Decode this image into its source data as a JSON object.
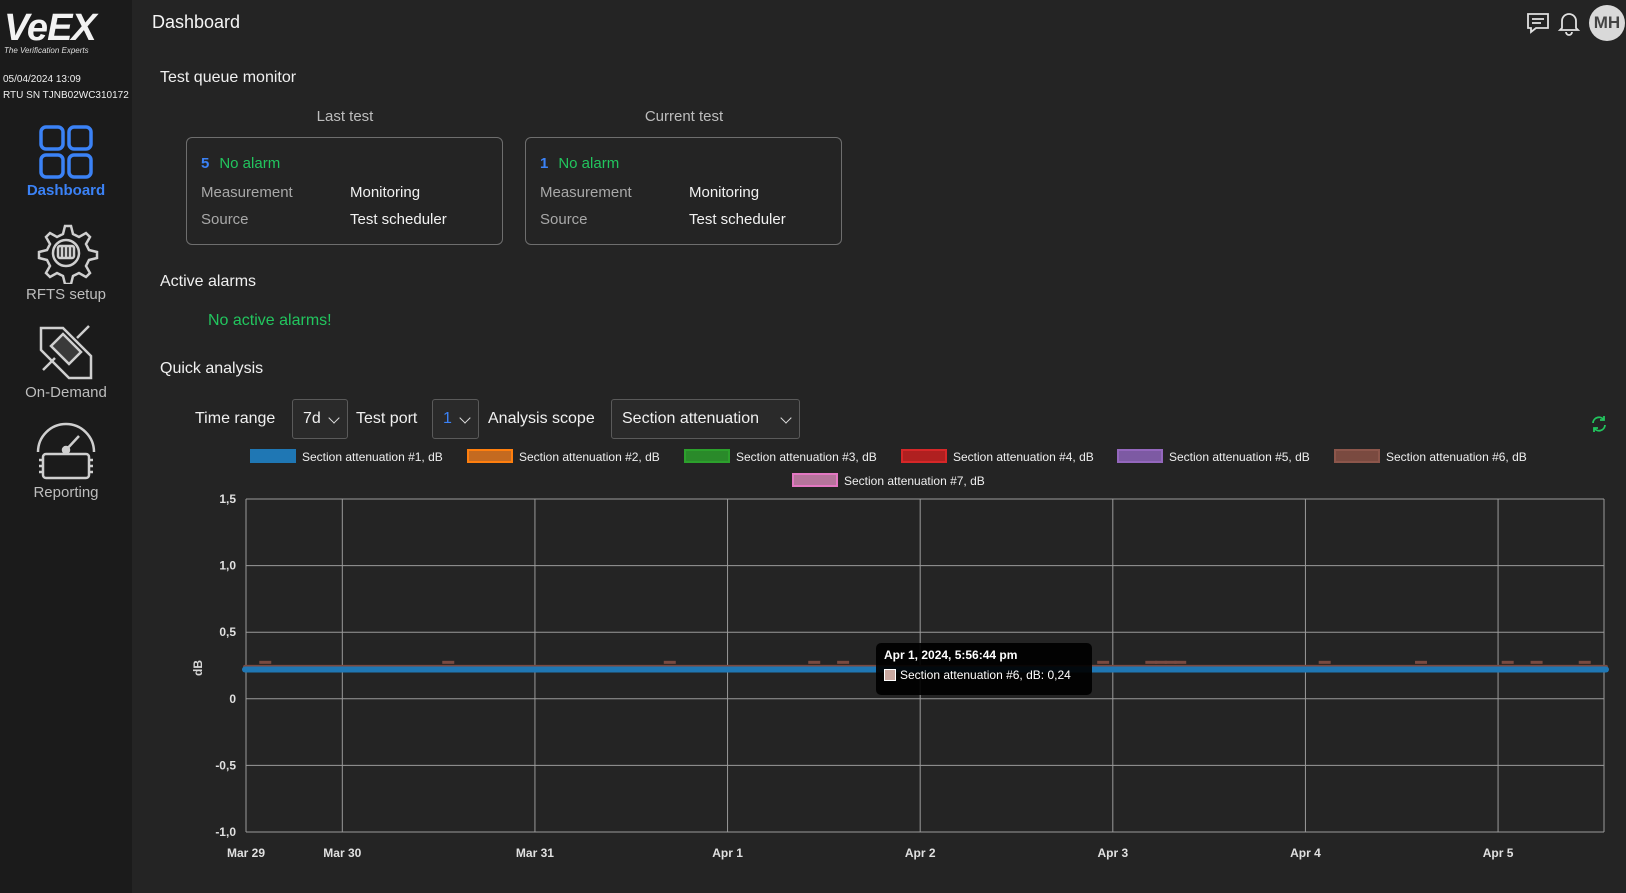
{
  "sidebar": {
    "brand": "VeEX",
    "tagline": "The Verification Experts",
    "datetime": "05/04/2024 13:09",
    "serial": "RTU SN TJNB02WC310172",
    "items": [
      {
        "label": "Dashboard",
        "icon": "dashboard-grid-icon",
        "active": true
      },
      {
        "label": "RFTS setup",
        "icon": "gear-icon",
        "active": false
      },
      {
        "label": "On-Demand",
        "icon": "on-demand-icon",
        "active": false
      },
      {
        "label": "Reporting",
        "icon": "gauge-icon",
        "active": false
      }
    ]
  },
  "header": {
    "title": "Dashboard",
    "icons": [
      "chat-icon",
      "bell-icon"
    ],
    "avatar_initials": "MH"
  },
  "test_queue": {
    "title": "Test queue monitor",
    "last": {
      "heading": "Last test",
      "count": "5",
      "status": "No alarm",
      "measurement_label": "Measurement",
      "measurement_value": "Monitoring",
      "source_label": "Source",
      "source_value": "Test scheduler"
    },
    "current": {
      "heading": "Current test",
      "count": "1",
      "status": "No alarm",
      "measurement_label": "Measurement",
      "measurement_value": "Monitoring",
      "source_label": "Source",
      "source_value": "Test scheduler"
    }
  },
  "active_alarms": {
    "title": "Active alarms",
    "message": "No active alarms!"
  },
  "quick_analysis": {
    "title": "Quick analysis",
    "time_range_label": "Time range",
    "time_range_value": "7d",
    "test_port_label": "Test port",
    "test_port_value": "1",
    "scope_label": "Analysis scope",
    "scope_value": "Section attenuation",
    "refresh_icon": "refresh-icon"
  },
  "colors": {
    "accent": "#3b82f6",
    "ok": "#22c55e"
  },
  "chart_data": {
    "type": "line",
    "ylabel": "dB",
    "ylim": [
      -1.0,
      1.5
    ],
    "yticks": [
      "1,5",
      "1,0",
      "0,5",
      "0",
      "-0,5",
      "-1,0"
    ],
    "yticks_values": [
      1.5,
      1.0,
      0.5,
      0,
      -0.5,
      -1.0
    ],
    "xticks": [
      "Mar 29",
      "Mar 30",
      "Mar 31",
      "Apr 1",
      "Apr 2",
      "Apr 3",
      "Apr 4",
      "Apr 5"
    ],
    "xticks_values": [
      0,
      0.5,
      1.5,
      2.5,
      3.5,
      4.5,
      5.5,
      6.5
    ],
    "xlim": [
      0,
      7.05
    ],
    "grid": true,
    "legend_position": "top",
    "series": [
      {
        "name": "Section attenuation #1, dB",
        "color": "#1f77b4",
        "fill": "#1f77b4",
        "value": 0.22
      },
      {
        "name": "Section attenuation #2, dB",
        "color": "#ff7f0e",
        "fill": "#c46a20",
        "value": 0.22
      },
      {
        "name": "Section attenuation #3, dB",
        "color": "#2ca02c",
        "fill": "#2a8a2a",
        "value": 0.22
      },
      {
        "name": "Section attenuation #4, dB",
        "color": "#d62728",
        "fill": "#b02020",
        "value": 0.22
      },
      {
        "name": "Section attenuation #5, dB",
        "color": "#9467bd",
        "fill": "#7d5aa3",
        "value": 0.22
      },
      {
        "name": "Section attenuation #6, dB",
        "color": "#8c564b",
        "fill": "#7a4a40",
        "value": 0.24
      },
      {
        "name": "Section attenuation #7, dB",
        "color": "#e377c2",
        "fill": "#b6749c",
        "value": 0.22
      }
    ],
    "tooltip": {
      "title": "Apr 1, 2024, 5:56:44 pm",
      "text": "Section attenuation #6, dB: 0,24"
    }
  }
}
